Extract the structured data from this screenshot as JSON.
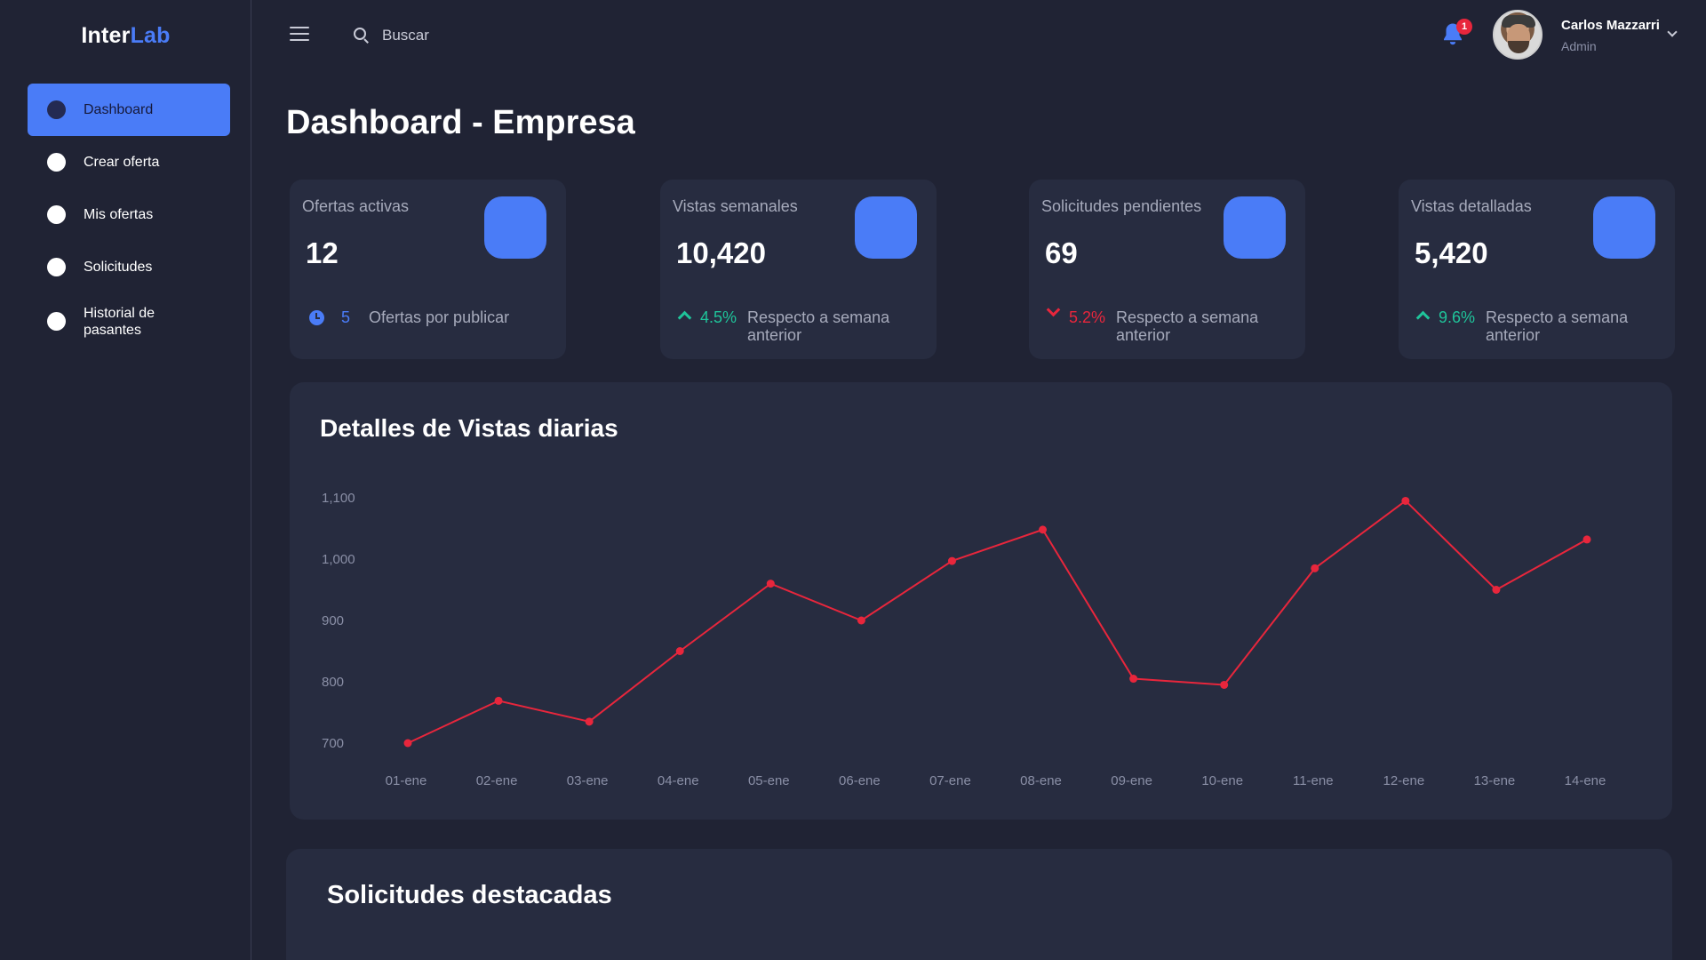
{
  "brand": {
    "name_part1": "Inter",
    "name_part2": "Lab",
    "accent": "#4a7cf7"
  },
  "sidebar": {
    "items": [
      {
        "label": "Dashboard",
        "active": true
      },
      {
        "label": "Crear oferta",
        "active": false
      },
      {
        "label": "Mis ofertas",
        "active": false
      },
      {
        "label": "Solicitudes",
        "active": false
      },
      {
        "label": "Historial de pasantes",
        "active": false
      }
    ]
  },
  "topbar": {
    "search_placeholder": "Buscar",
    "notifications_count": "1",
    "user_name": "Carlos Mazzarri",
    "user_role": "Admin"
  },
  "page": {
    "title": "Dashboard - Empresa"
  },
  "cards": [
    {
      "label": "Ofertas activas",
      "value": "12",
      "pending_count": "5",
      "foot_text": "Ofertas por publicar"
    },
    {
      "label": "Vistas semanales",
      "value": "10,420",
      "trend": "4.5%",
      "direction": "up",
      "foot_text": "Respecto a semana anterior"
    },
    {
      "label": "Solicitudes pendientes",
      "value": "69",
      "trend": "5.2%",
      "direction": "down",
      "foot_text": "Respecto a semana anterior"
    },
    {
      "label": "Vistas detalladas",
      "value": "5,420",
      "trend": "9.6%",
      "direction": "up",
      "foot_text": "Respecto a semana anterior"
    }
  ],
  "chart_panel": {
    "title": "Detalles de Vistas diarias"
  },
  "chart_data": {
    "type": "line",
    "title": "Detalles de Vistas diarias",
    "categories": [
      "01-ene",
      "02-ene",
      "03-ene",
      "04-ene",
      "05-ene",
      "06-ene",
      "07-ene",
      "08-ene",
      "09-ene",
      "10-ene",
      "11-ene",
      "12-ene",
      "13-ene",
      "14-ene"
    ],
    "series": [
      {
        "values": [
          700,
          769,
          735,
          850,
          960,
          900,
          997,
          1048,
          805,
          795,
          985,
          1095,
          950,
          1032
        ],
        "color": "#e8263c"
      }
    ],
    "y_ticks": [
      "700",
      "800",
      "900",
      "1,000",
      "1,100"
    ],
    "ylim": [
      700,
      1100
    ],
    "grid": false
  },
  "requests_panel": {
    "title": "Solicitudes destacadas"
  },
  "colors": {
    "background": "#202334",
    "card": "#272c40",
    "accent": "#4a7cf7",
    "up": "#1fc49a",
    "down": "#e8263c"
  }
}
